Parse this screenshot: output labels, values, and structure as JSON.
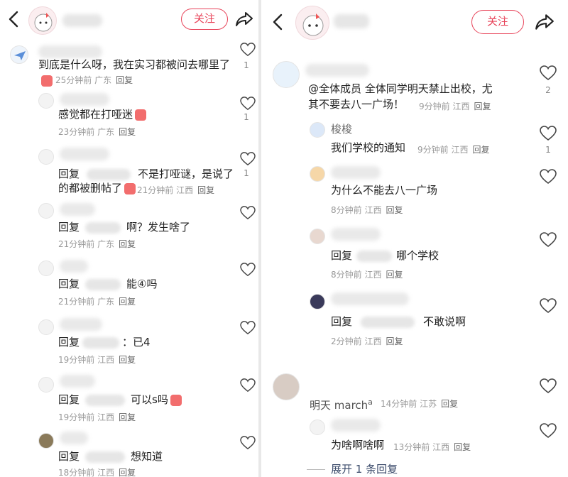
{
  "left": {
    "header": {
      "back_icon": "chevron-left-icon",
      "follow_label": "关注",
      "share_icon": "share-icon"
    },
    "comments": [
      {
        "text": "到底是什么呀，我在实习都被问去哪里了",
        "time": "25分钟前",
        "location": "广东",
        "reply": "回复",
        "likes": "1",
        "is_reply": false
      },
      {
        "text": "感觉都在打哑迷",
        "time": "23分钟前",
        "location": "广东",
        "reply": "回复",
        "likes": "1",
        "is_reply": true
      },
      {
        "prefix": "回复",
        "text_a": "不是打哑谜，是说了",
        "text_b": "的都被删帖了",
        "time": "21分钟前",
        "location": "江西",
        "reply": "回复",
        "likes": "1",
        "is_reply": true
      },
      {
        "prefix": "回复",
        "text": "啊？发生啥了",
        "time": "21分钟前",
        "location": "广东",
        "reply": "回复",
        "is_reply": true
      },
      {
        "prefix": "回复",
        "text": "能④吗",
        "time": "21分钟前",
        "location": "广东",
        "reply": "回复",
        "is_reply": true
      },
      {
        "prefix": "回复",
        "text": "：已4",
        "time": "19分钟前",
        "location": "江西",
        "reply": "回复",
        "is_reply": true
      },
      {
        "prefix": "回复",
        "text": "可以s吗",
        "time": "19分钟前",
        "location": "江西",
        "reply": "回复",
        "is_reply": true
      },
      {
        "prefix": "回复",
        "text": "想知道",
        "time": "18分钟前",
        "location": "江西",
        "reply": "回复",
        "is_reply": true
      }
    ]
  },
  "right": {
    "header": {
      "back_icon": "chevron-left-icon",
      "follow_label": "关注",
      "share_icon": "share-icon"
    },
    "comments": [
      {
        "text_a": "@全体成员 全体同学明天禁止出校，尤",
        "text_b": "其不要去八一广场！",
        "time": "9分钟前",
        "location": "江西",
        "reply": "回复",
        "likes": "2"
      },
      {
        "name": "梭梭",
        "text": "我们学校的通知",
        "time": "9分钟前",
        "location": "江西",
        "reply": "回复",
        "likes": "1"
      },
      {
        "text": "为什么不能去八一广场",
        "time": "8分钟前",
        "location": "江西",
        "reply": "回复"
      },
      {
        "prefix": "回复",
        "text": "哪个学校",
        "time": "8分钟前",
        "location": "江西",
        "reply": "回复"
      },
      {
        "prefix": "回复",
        "text": "不敢说啊",
        "time": "2分钟前",
        "location": "江西",
        "reply": "回复"
      },
      {
        "name": "明天 march",
        "time": "14分钟前",
        "location": "江苏",
        "reply": "回复"
      },
      {
        "text": "为啥啊啥啊",
        "time": "13分钟前",
        "location": "江西",
        "reply": "回复"
      }
    ],
    "expand_label": "展开 1 条回复"
  }
}
